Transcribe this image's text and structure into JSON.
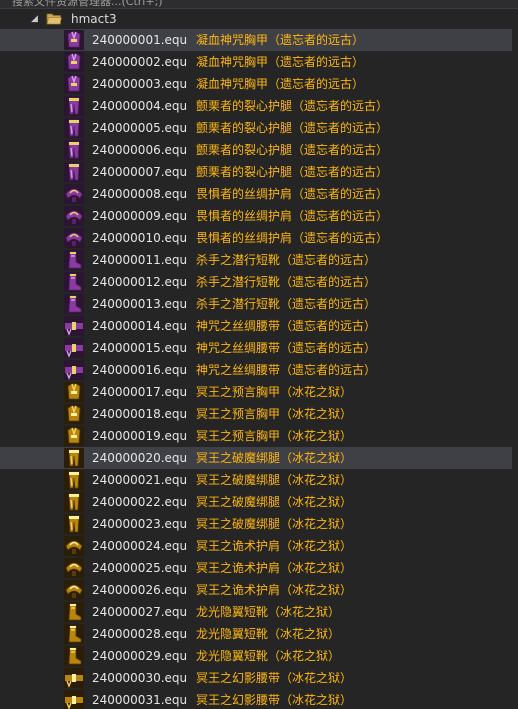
{
  "search": {
    "text": "搜索文件资源管理器...(Ctrl+;)"
  },
  "folder": {
    "name": "hmact3",
    "expanded": true
  },
  "colors": {
    "item_name": "#ffb70f",
    "file_name": "#e6e6e6",
    "selected_bg": "#3f3f46",
    "background": "#252526"
  },
  "files": [
    {
      "file": "240000001.equ",
      "name": "凝血神咒胸甲（遗忘者的远古）",
      "icon": "armor-purple-icon",
      "selected": true
    },
    {
      "file": "240000002.equ",
      "name": "凝血神咒胸甲（遗忘者的远古）",
      "icon": "armor-purple-icon",
      "selected": false
    },
    {
      "file": "240000003.equ",
      "name": "凝血神咒胸甲（遗忘者的远古）",
      "icon": "armor-purple-icon",
      "selected": false
    },
    {
      "file": "240000004.equ",
      "name": "颤栗者的裂心护腿（遗忘者的远古）",
      "icon": "legs-purple-icon",
      "selected": false
    },
    {
      "file": "240000005.equ",
      "name": "颤栗者的裂心护腿（遗忘者的远古）",
      "icon": "legs-purple-icon",
      "selected": false
    },
    {
      "file": "240000006.equ",
      "name": "颤栗者的裂心护腿（遗忘者的远古）",
      "icon": "legs-purple-icon",
      "selected": false
    },
    {
      "file": "240000007.equ",
      "name": "颤栗者的裂心护腿（遗忘者的远古）",
      "icon": "legs-purple-icon",
      "selected": false
    },
    {
      "file": "240000008.equ",
      "name": "畏惧者的丝绸护肩（遗忘者的远古）",
      "icon": "shoulder-purple-icon",
      "selected": false
    },
    {
      "file": "240000009.equ",
      "name": "畏惧者的丝绸护肩（遗忘者的远古）",
      "icon": "shoulder-purple-icon",
      "selected": false
    },
    {
      "file": "240000010.equ",
      "name": "畏惧者的丝绸护肩（遗忘者的远古）",
      "icon": "shoulder-purple-icon",
      "selected": false
    },
    {
      "file": "240000011.equ",
      "name": "杀手之潜行短靴（遗忘者的远古）",
      "icon": "boots-purple-icon",
      "selected": false
    },
    {
      "file": "240000012.equ",
      "name": "杀手之潜行短靴（遗忘者的远古）",
      "icon": "boots-purple-icon",
      "selected": false
    },
    {
      "file": "240000013.equ",
      "name": "杀手之潜行短靴（遗忘者的远古）",
      "icon": "boots-purple-icon",
      "selected": false
    },
    {
      "file": "240000014.equ",
      "name": "神咒之丝绸腰带（遗忘者的远古）",
      "icon": "belt-purple-icon",
      "selected": false
    },
    {
      "file": "240000015.equ",
      "name": "神咒之丝绸腰带（遗忘者的远古）",
      "icon": "belt-purple-icon",
      "selected": false
    },
    {
      "file": "240000016.equ",
      "name": "神咒之丝绸腰带（遗忘者的远古）",
      "icon": "belt-purple-icon",
      "selected": false
    },
    {
      "file": "240000017.equ",
      "name": "冥王之预言胸甲（冰花之狱）",
      "icon": "armor-gold-icon",
      "selected": false
    },
    {
      "file": "240000018.equ",
      "name": "冥王之预言胸甲（冰花之狱）",
      "icon": "armor-gold-icon",
      "selected": false
    },
    {
      "file": "240000019.equ",
      "name": "冥王之预言胸甲（冰花之狱）",
      "icon": "armor-gold-icon",
      "selected": false
    },
    {
      "file": "240000020.equ",
      "name": "冥王之破魔绑腿（冰花之狱）",
      "icon": "legs-gold-icon",
      "selected": true
    },
    {
      "file": "240000021.equ",
      "name": "冥王之破魔绑腿（冰花之狱）",
      "icon": "legs-gold-icon",
      "selected": false
    },
    {
      "file": "240000022.equ",
      "name": "冥王之破魔绑腿（冰花之狱）",
      "icon": "legs-gold-icon",
      "selected": false
    },
    {
      "file": "240000023.equ",
      "name": "冥王之破魔绑腿（冰花之狱）",
      "icon": "legs-gold-icon",
      "selected": false
    },
    {
      "file": "240000024.equ",
      "name": "冥王之诡术护肩（冰花之狱）",
      "icon": "shoulder-gold-icon",
      "selected": false
    },
    {
      "file": "240000025.equ",
      "name": "冥王之诡术护肩（冰花之狱）",
      "icon": "shoulder-gold-icon",
      "selected": false
    },
    {
      "file": "240000026.equ",
      "name": "冥王之诡术护肩（冰花之狱）",
      "icon": "shoulder-gold-icon",
      "selected": false
    },
    {
      "file": "240000027.equ",
      "name": "龙光隐翼短靴（冰花之狱）",
      "icon": "boots-gold-icon",
      "selected": false
    },
    {
      "file": "240000028.equ",
      "name": "龙光隐翼短靴（冰花之狱）",
      "icon": "boots-gold-icon",
      "selected": false
    },
    {
      "file": "240000029.equ",
      "name": "龙光隐翼短靴（冰花之狱）",
      "icon": "boots-gold-icon",
      "selected": false
    },
    {
      "file": "240000030.equ",
      "name": "冥王之幻影腰带（冰花之狱）",
      "icon": "belt-gold-icon",
      "selected": false
    },
    {
      "file": "240000031.equ",
      "name": "冥王之幻影腰带（冰花之狱）",
      "icon": "belt-gold-icon",
      "selected": false
    }
  ]
}
